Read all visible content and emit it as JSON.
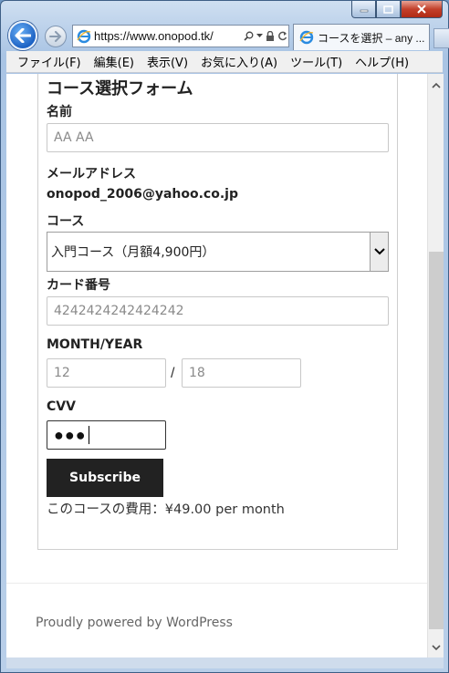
{
  "browser": {
    "url": "https://www.onopod.tk/",
    "tab_title": "コースを選択 – any ...",
    "menu": [
      "ファイル(F)",
      "編集(E)",
      "表示(V)",
      "お気に入り(A)",
      "ツール(T)",
      "ヘルプ(H)"
    ]
  },
  "form": {
    "title": "コース選択フォーム",
    "name_label": "名前",
    "name_placeholder": "AA AA",
    "email_label": "メールアドレス",
    "email_value": "onopod_2006@yahoo.co.jp",
    "course_label": "コース",
    "course_selected": "入門コース（月額4,900円）",
    "card_label": "カード番号",
    "card_placeholder": "4242424242424242",
    "month_year_label": "MONTH/YEAR",
    "month_placeholder": "12",
    "separator": "/",
    "year_placeholder": "18",
    "cvv_label": "CVV",
    "cvv_value": "●●●",
    "subscribe_label": "Subscribe",
    "cost_text": "このコースの費用：¥49.00 per month"
  },
  "footer": {
    "text": "Proudly powered by WordPress"
  },
  "colors": {
    "button_bg": "#222222",
    "ie_blue": "#1c62c4",
    "close_red": "#c3402b"
  }
}
